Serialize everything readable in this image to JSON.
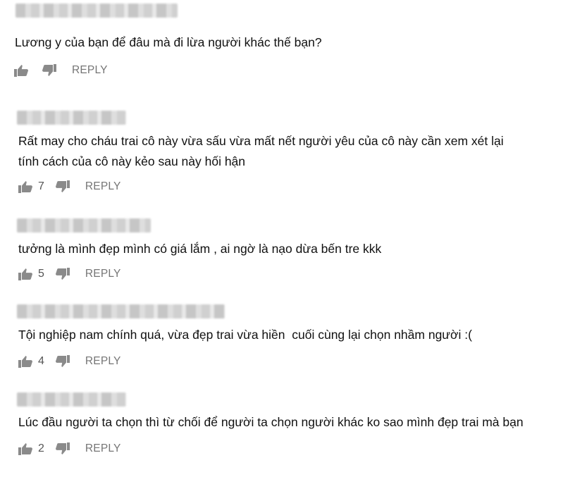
{
  "comments": [
    {
      "author": "",
      "text": "Lương y của bạn để đâu mà đi lừa người khác thế bạn?",
      "likes": "",
      "reply_label": "REPLY"
    },
    {
      "author": "",
      "text": "Rất may cho cháu trai cô này vừa sấu vừa mất nết người yêu của cô này cần xem xét lại\ntính cách của cô này kẻo sau này hối hận",
      "likes": "7",
      "reply_label": "REPLY"
    },
    {
      "author": "",
      "text": "tưởng là mình đẹp mình có giá lắm , ai ngờ là nạo dừa bến tre kkk",
      "likes": "5",
      "reply_label": "REPLY"
    },
    {
      "author": "",
      "text": "Tội nghiệp nam chính quá, vừa đẹp trai vừa hiền  cuối cùng lại chọn nhầm người :(",
      "likes": "4",
      "reply_label": "REPLY"
    },
    {
      "author": "",
      "text": "Lúc đầu người ta chọn thì từ chối để người ta chọn người khác ko sao mình đẹp trai mà bạn",
      "likes": "2",
      "reply_label": "REPLY"
    }
  ],
  "icons": {
    "like": "thumbs-up-icon",
    "dislike": "thumbs-down-icon"
  },
  "colors": {
    "text": "#111111",
    "muted": "#757575",
    "icon": "#8a8a8a"
  }
}
